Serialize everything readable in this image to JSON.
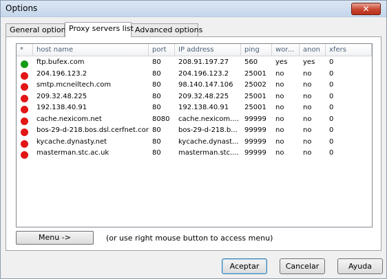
{
  "window": {
    "title": "Options",
    "close_glyph": "✕"
  },
  "tabs": [
    {
      "label": "General options"
    },
    {
      "label": "Proxy servers list",
      "active": true
    },
    {
      "label": "Advanced options"
    }
  ],
  "table": {
    "columns": [
      "*",
      "host name",
      "port",
      "IP address",
      "ping",
      "wor...",
      "anon",
      "xfers"
    ],
    "rows": [
      {
        "status": "green",
        "host": "ftp.bufex.com",
        "port": "80",
        "ip": "208.91.197.27",
        "ping": "560",
        "works": "yes",
        "anon": "yes",
        "xfers": "0"
      },
      {
        "status": "red",
        "host": "204.196.123.2",
        "port": "80",
        "ip": "204.196.123.2",
        "ping": "25001",
        "works": "no",
        "anon": "no",
        "xfers": "0"
      },
      {
        "status": "red",
        "host": "smtp.mcneiltech.com",
        "port": "80",
        "ip": "98.140.147.106",
        "ping": "25002",
        "works": "no",
        "anon": "no",
        "xfers": "0"
      },
      {
        "status": "red",
        "host": "209.32.48.225",
        "port": "80",
        "ip": "209.32.48.225",
        "ping": "25001",
        "works": "no",
        "anon": "no",
        "xfers": "0"
      },
      {
        "status": "red",
        "host": "192.138.40.91",
        "port": "80",
        "ip": "192.138.40.91",
        "ping": "25001",
        "works": "no",
        "anon": "no",
        "xfers": "0"
      },
      {
        "status": "red",
        "host": "cache.nexicom.net",
        "port": "8080",
        "ip": "cache.nexicom....",
        "ping": "99999",
        "works": "no",
        "anon": "no",
        "xfers": "0"
      },
      {
        "status": "red",
        "host": "bos-29-d-218.bos.dsl.cerfnet.com",
        "port": "80",
        "ip": "bos-29-d-218.b...",
        "ping": "99999",
        "works": "no",
        "anon": "no",
        "xfers": "0"
      },
      {
        "status": "red",
        "host": "kycache.dynasty.net",
        "port": "80",
        "ip": "kycache.dynast...",
        "ping": "99999",
        "works": "no",
        "anon": "no",
        "xfers": "0"
      },
      {
        "status": "red",
        "host": "masterman.stc.ac.uk",
        "port": "80",
        "ip": "masterman.stc....",
        "ping": "99999",
        "works": "no",
        "anon": "no",
        "xfers": "0"
      }
    ]
  },
  "colors": {
    "green": "#169b16",
    "red": "#e21616"
  },
  "menu_button": "Menu ->",
  "hint": "(or use right mouse button to access menu)",
  "buttons": {
    "accept": "Aceptar",
    "cancel": "Cancelar",
    "help": "Ayuda"
  }
}
